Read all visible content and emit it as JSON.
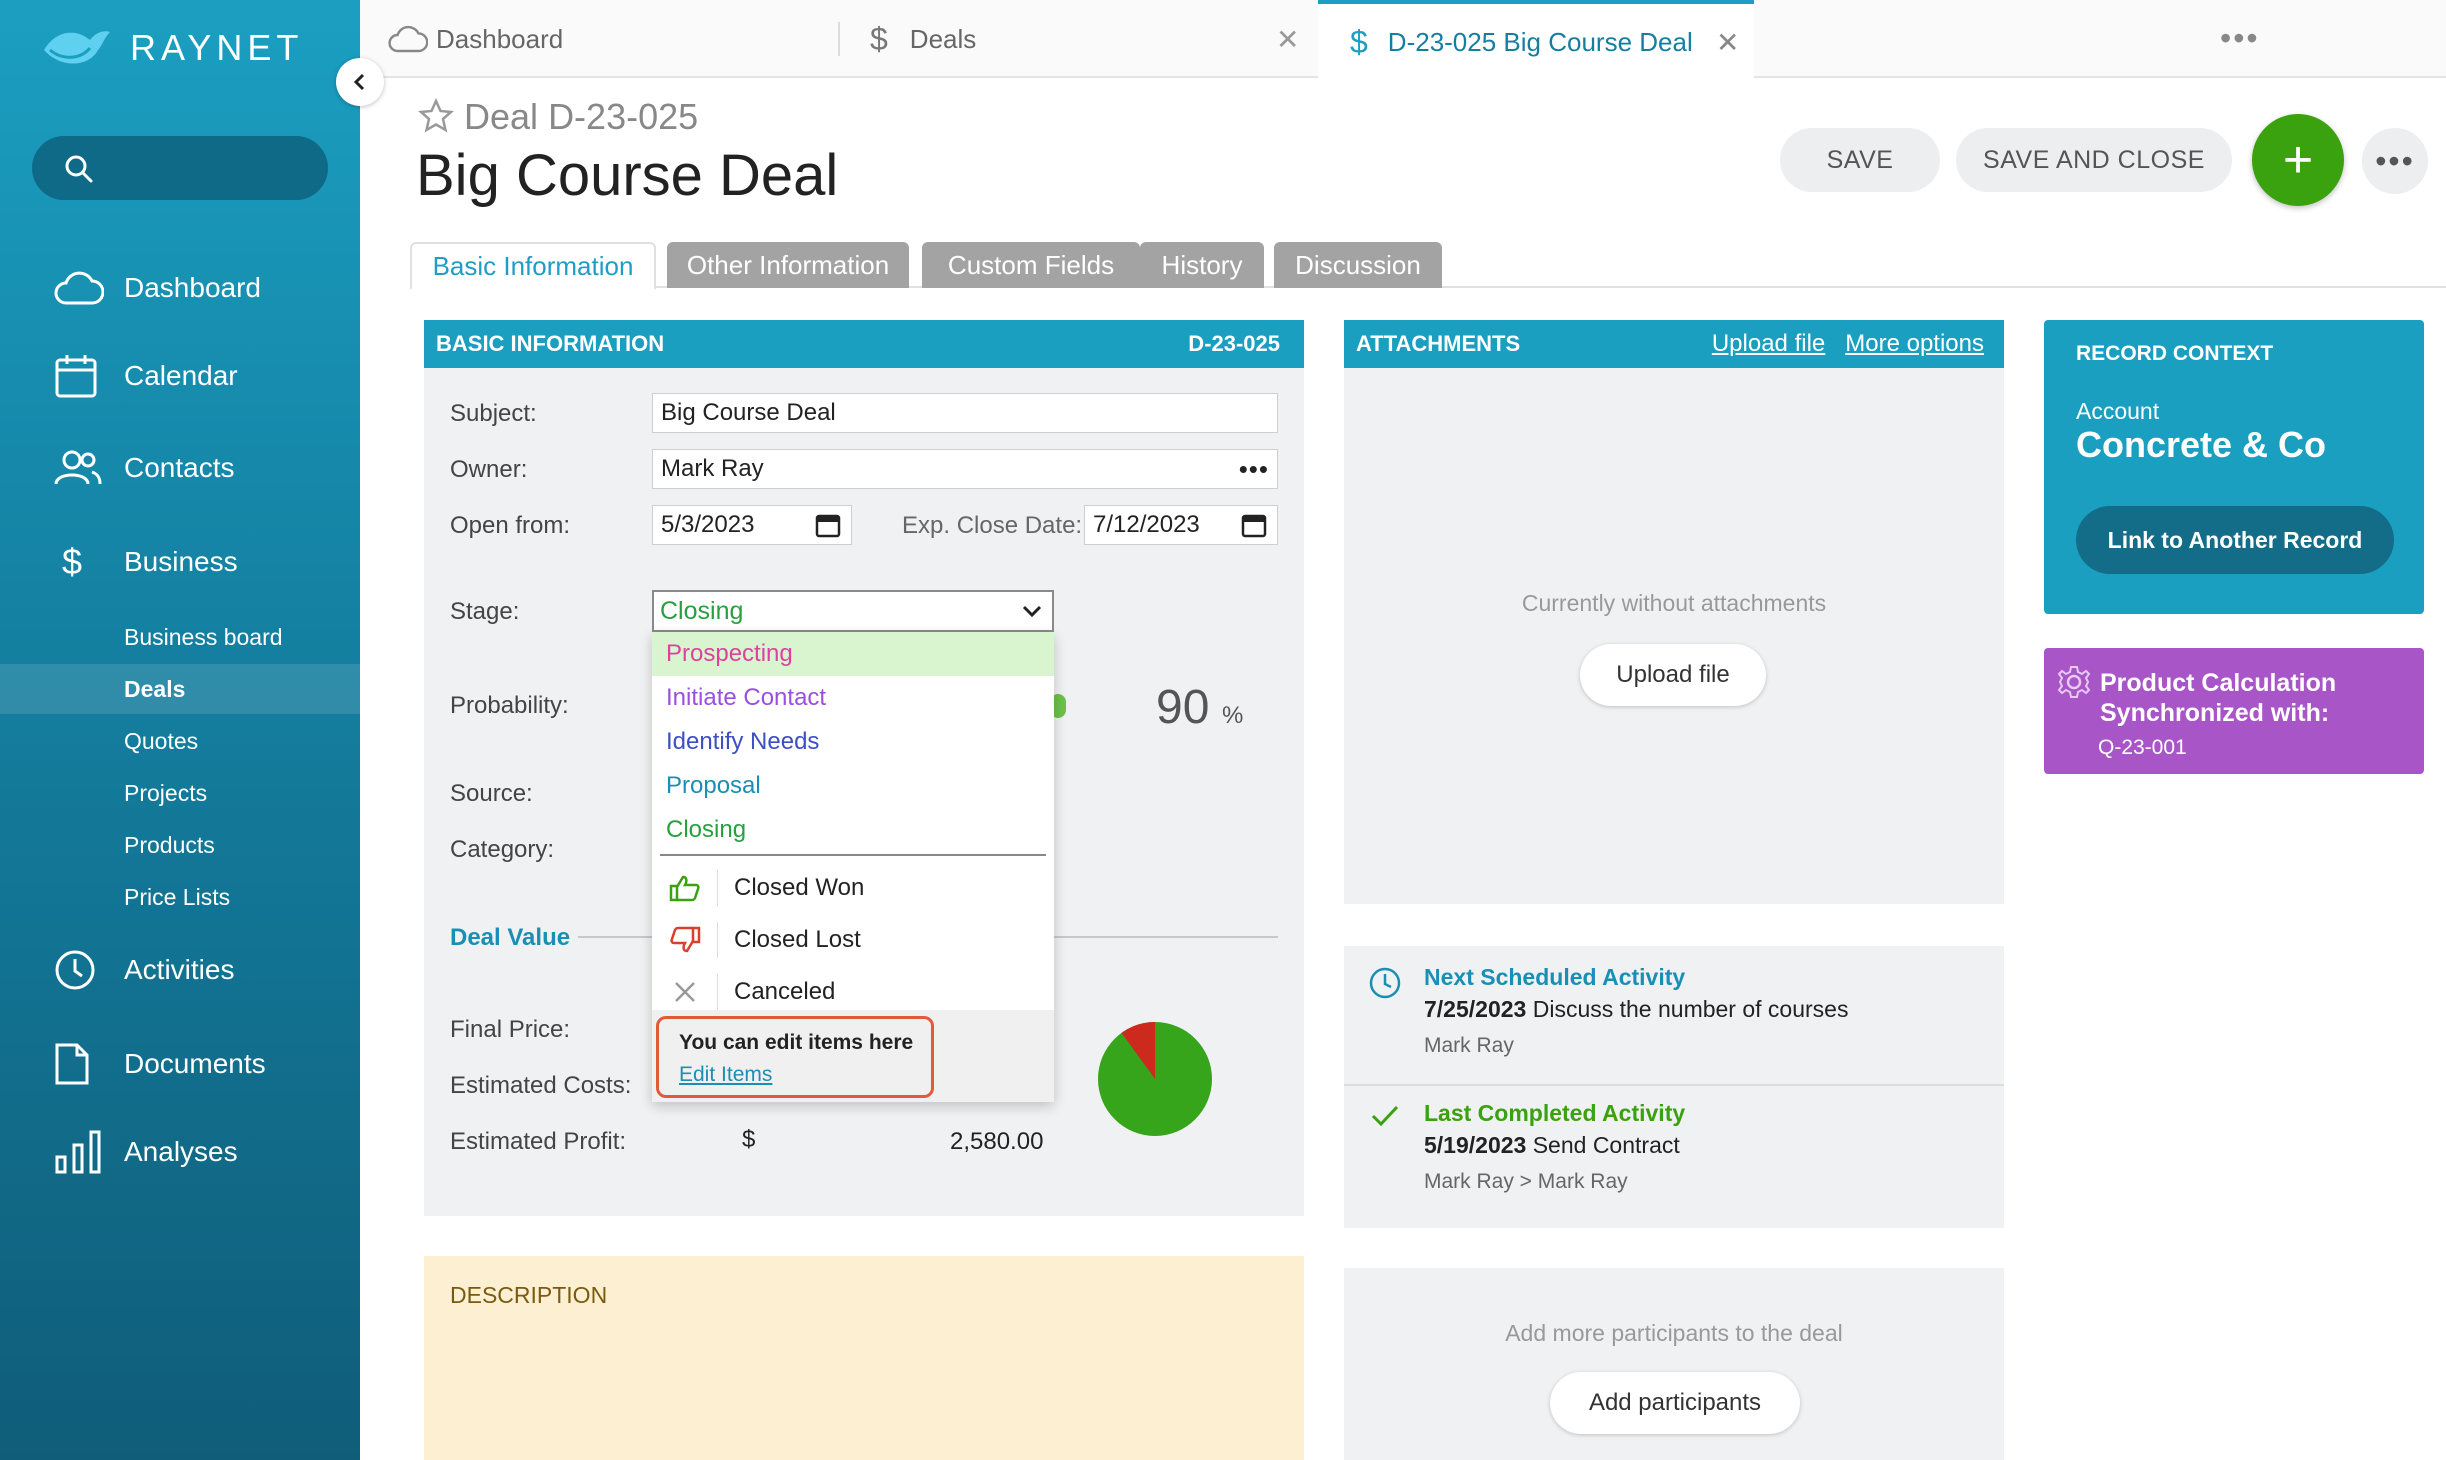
{
  "app": {
    "logo_text": "RAYNET"
  },
  "sidebar": {
    "search_placeholder": "",
    "items": [
      {
        "label": "Dashboard",
        "icon": "cloud-icon"
      },
      {
        "label": "Calendar",
        "icon": "calendar-icon"
      },
      {
        "label": "Contacts",
        "icon": "contacts-icon"
      },
      {
        "label": "Business",
        "icon": "dollar-icon"
      },
      {
        "label": "Activities",
        "icon": "clock-icon"
      },
      {
        "label": "Documents",
        "icon": "document-icon"
      },
      {
        "label": "Analyses",
        "icon": "bar-chart-icon"
      }
    ],
    "sub_items": [
      "Business board",
      "Deals",
      "Quotes",
      "Projects",
      "Products",
      "Price Lists"
    ],
    "active_sub": "Deals"
  },
  "tabs": [
    {
      "label": "Dashboard",
      "icon": "cloud-icon"
    },
    {
      "label": "Deals",
      "icon": "dollar-icon"
    },
    {
      "label": "D-23-025 Big Course Deal",
      "icon": "dollar-icon",
      "active": true
    }
  ],
  "tabs_more": "•••",
  "header": {
    "record_type": "Deal",
    "record_id": "D-23-025",
    "title": "Big Course Deal",
    "save_label": "SAVE",
    "save_close_label": "SAVE AND CLOSE",
    "add_label": "+",
    "more_label": "•••"
  },
  "form_tabs": [
    "Basic Information",
    "Other Information",
    "Custom Fields",
    "History",
    "Discussion"
  ],
  "basic_info": {
    "header": "BASIC INFORMATION",
    "code": "D-23-025",
    "subject_label": "Subject:",
    "subject_value": "Big Course Deal",
    "owner_label": "Owner:",
    "owner_value": "Mark Ray",
    "open_from_label": "Open from:",
    "open_from_value": "5/3/2023",
    "exp_close_label": "Exp. Close Date:",
    "exp_close_value": "7/12/2023",
    "stage_label": "Stage:",
    "stage_value": "Closing",
    "probability_label": "Probability:",
    "probability_value": "90",
    "probability_unit": "%",
    "source_label": "Source:",
    "category_label": "Category:",
    "deal_value_label": "Deal Value",
    "final_price_label": "Final Price:",
    "estimated_costs_label": "Estimated Costs:",
    "estimated_profit_label": "Estimated Profit:",
    "profit_currency": "$",
    "profit_value": "2,580.00"
  },
  "profit_pie": {
    "profit_fraction": 0.9,
    "colors": {
      "profit": "#36a51b",
      "cost": "#cc2a1c"
    }
  },
  "stage_dropdown": {
    "stages": [
      {
        "label": "Prospecting",
        "color": "#e040a0"
      },
      {
        "label": "Initiate Contact",
        "color": "#9b4fe0"
      },
      {
        "label": "Identify Needs",
        "color": "#3c4fc4"
      },
      {
        "label": "Proposal",
        "color": "#1a8fb5"
      },
      {
        "label": "Closing",
        "color": "#27a040"
      }
    ],
    "outcomes": [
      {
        "label": "Closed Won",
        "icon": "thumbs-up-icon"
      },
      {
        "label": "Closed Lost",
        "icon": "thumbs-down-icon"
      },
      {
        "label": "Canceled",
        "icon": "close-icon"
      }
    ],
    "hint": "You can edit items here",
    "edit_link": "Edit Items"
  },
  "attachments": {
    "header": "ATTACHMENTS",
    "upload_link": "Upload file",
    "more_link": "More options",
    "empty_text": "Currently without attachments",
    "upload_button": "Upload file"
  },
  "activities": {
    "next_title": "Next Scheduled Activity",
    "next_date": "7/25/2023",
    "next_text": "Discuss the number of courses",
    "next_person": "Mark Ray",
    "last_title": "Last Completed Activity",
    "last_date": "5/19/2023",
    "last_text": "Send Contract",
    "last_person": "Mark Ray > Mark Ray"
  },
  "participants": {
    "text": "Add more participants to the deal",
    "button": "Add participants"
  },
  "description": {
    "header": "DESCRIPTION"
  },
  "record_context": {
    "header": "RECORD CONTEXT",
    "account_label": "Account",
    "account_name": "Concrete & Co",
    "link_button": "Link to Another Record"
  },
  "product_calc": {
    "title": "Product Calculation Synchronized with:",
    "quote": "Q-23-001"
  },
  "colors": {
    "brand": "#1b9fc1",
    "accent_green": "#3aa10f",
    "purple": "#a855c8"
  }
}
